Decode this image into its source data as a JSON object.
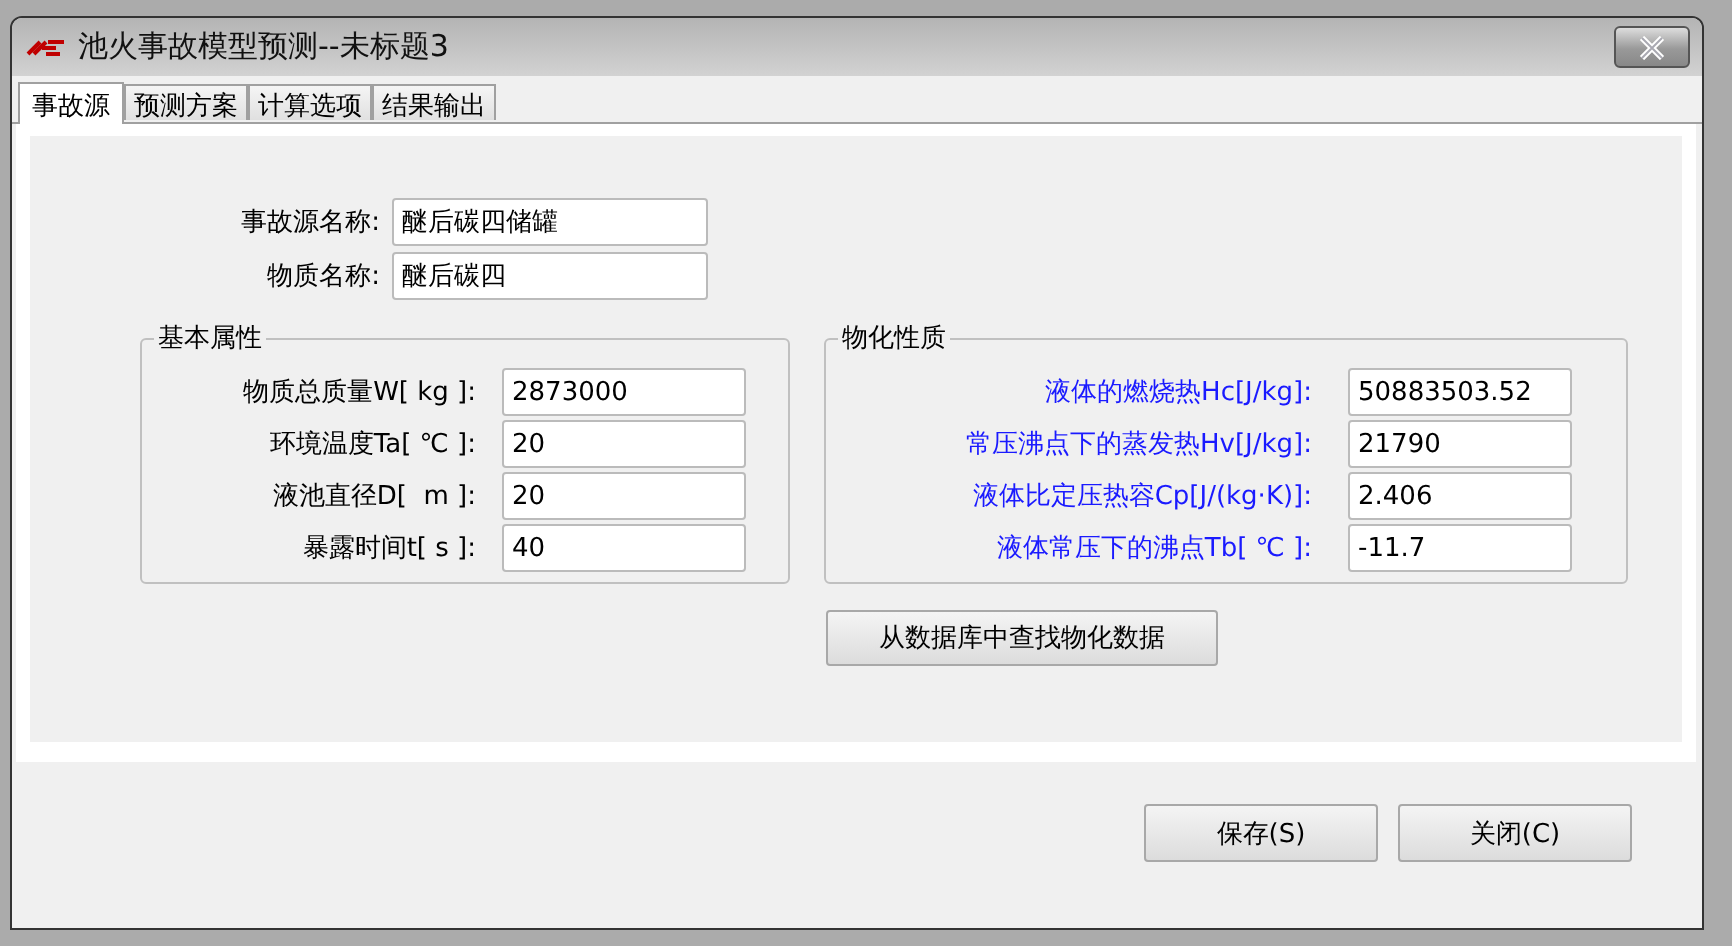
{
  "window": {
    "title": "池火事故模型预测--未标题3"
  },
  "tabs": [
    {
      "label": "事故源",
      "selected": true
    },
    {
      "label": "预测方案",
      "selected": false
    },
    {
      "label": "计算选项",
      "selected": false
    },
    {
      "label": "结果输出",
      "selected": false
    }
  ],
  "source_fields": [
    {
      "label": "事故源名称:",
      "value": "醚后碳四储罐"
    },
    {
      "label": "物质名称:",
      "value": "醚后碳四"
    }
  ],
  "groups": [
    {
      "title": "基本属性",
      "kind": "plain",
      "fields": [
        {
          "label": "物质总质量W[ kg ]:",
          "value": "2873000"
        },
        {
          "label": "环境温度Ta[ ℃ ]:",
          "value": "20"
        },
        {
          "label": "液池直径D[  m ]:",
          "value": "20"
        },
        {
          "label": "暴露时间t[ s ]:",
          "value": "40"
        }
      ]
    },
    {
      "title": "物化性质",
      "kind": "highlight",
      "fields": [
        {
          "label": "液体的燃烧热Hc[J/kg]:",
          "value": "50883503.52"
        },
        {
          "label": "常压沸点下的蒸发热Hv[J/kg]:",
          "value": "21790"
        },
        {
          "label": "液体比定压热容Cp[J/(kg·K)]:",
          "value": "2.406"
        },
        {
          "label": "液体常压下的沸点Tb[ ℃ ]:",
          "value": "-11.7"
        }
      ]
    }
  ],
  "lookup_button": "从数据库中查找物化数据",
  "buttons": [
    "保存(S)",
    "关闭(C)"
  ]
}
